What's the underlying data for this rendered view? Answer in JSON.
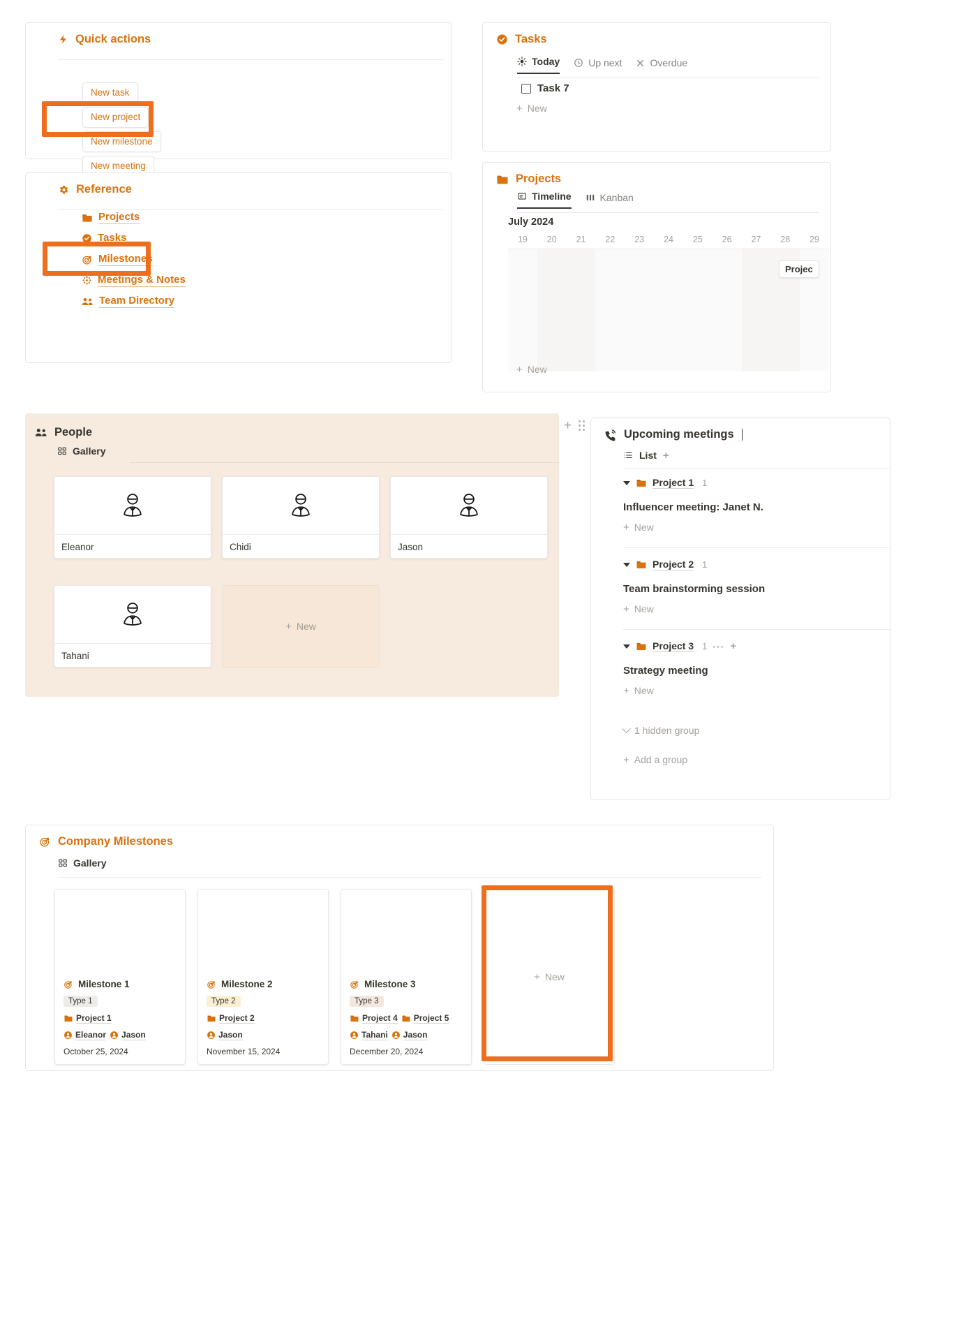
{
  "quick_actions": {
    "title": "Quick actions",
    "icon": "bolt-icon",
    "buttons": [
      "New task",
      "New project",
      "New milestone",
      "New meeting"
    ]
  },
  "reference": {
    "title": "Reference",
    "icon": "gear-icon",
    "items": [
      {
        "label": "Projects",
        "icon": "folder-icon"
      },
      {
        "label": "Tasks",
        "icon": "check-circle-icon"
      },
      {
        "label": "Milestones",
        "icon": "target-icon"
      },
      {
        "label": "Meetings & Notes",
        "icon": "asterisk-icon"
      },
      {
        "label": "Team Directory",
        "icon": "people-icon"
      }
    ]
  },
  "tasks": {
    "title": "Tasks",
    "icon": "check-circle-icon",
    "tabs": [
      {
        "label": "Today",
        "icon": "sun-icon",
        "active": true
      },
      {
        "label": "Up next",
        "icon": "clock-icon",
        "active": false
      },
      {
        "label": "Overdue",
        "icon": "x-icon",
        "active": false
      }
    ],
    "rows": [
      "Task 7"
    ],
    "new_label": "New"
  },
  "projects": {
    "title": "Projects",
    "icon": "folder-icon",
    "tabs": [
      {
        "label": "Timeline",
        "icon": "timeline-icon",
        "active": true
      },
      {
        "label": "Kanban",
        "icon": "columns-icon",
        "active": false
      }
    ],
    "month": "July 2024",
    "days": [
      "19",
      "20",
      "21",
      "22",
      "23",
      "24",
      "25",
      "26",
      "27",
      "28",
      "29"
    ],
    "bar_label": "Projec",
    "new_label": "New"
  },
  "people": {
    "title": "People",
    "icon": "people-icon",
    "view": {
      "label": "Gallery",
      "icon": "gallery-icon"
    },
    "cards": [
      "Eleanor",
      "Chidi",
      "Jason",
      "Tahani"
    ],
    "new_label": "New",
    "background": "#f7ebdf"
  },
  "meetings": {
    "title": "Upcoming meetings",
    "icon": "phone-ring-icon",
    "view": {
      "label": "List",
      "icon": "list-icon"
    },
    "groups": [
      {
        "name": "Project 1",
        "count": "1",
        "item": "Influencer meeting: Janet N.",
        "new_label": "New",
        "menu": false
      },
      {
        "name": "Project 2",
        "count": "1",
        "item": "Team brainstorming session",
        "new_label": "New",
        "menu": false
      },
      {
        "name": "Project 3",
        "count": "1",
        "item": "Strategy meeting",
        "new_label": "New",
        "menu": true,
        "dots": "···"
      }
    ],
    "hidden_group_label": "1 hidden group",
    "add_group_label": "Add a group"
  },
  "milestones": {
    "title": "Company Milestones",
    "icon": "target-icon",
    "view": {
      "label": "Gallery",
      "icon": "gallery-icon"
    },
    "new_label": "New",
    "cards": [
      {
        "name": "Milestone 1",
        "type": "Type 1",
        "type_color": "#edece9",
        "projects": [
          "Project 1"
        ],
        "people": [
          "Eleanor",
          "Jason"
        ],
        "date": "October 25, 2024"
      },
      {
        "name": "Milestone 2",
        "type": "Type 2",
        "type_color": "#faeed3",
        "projects": [
          "Project 2"
        ],
        "people": [
          "Jason"
        ],
        "date": "November 15, 2024"
      },
      {
        "name": "Milestone 3",
        "type": "Type 3",
        "type_color": "#f3e7e0",
        "projects": [
          "Project 4",
          "Project 5"
        ],
        "people": [
          "Tahani",
          "Jason"
        ],
        "date": "December 20, 2024"
      }
    ]
  },
  "theme": {
    "accent": "#d9730d",
    "highlight": "#ed6f1e",
    "text": "#37352f",
    "muted": "#a5a29d"
  }
}
